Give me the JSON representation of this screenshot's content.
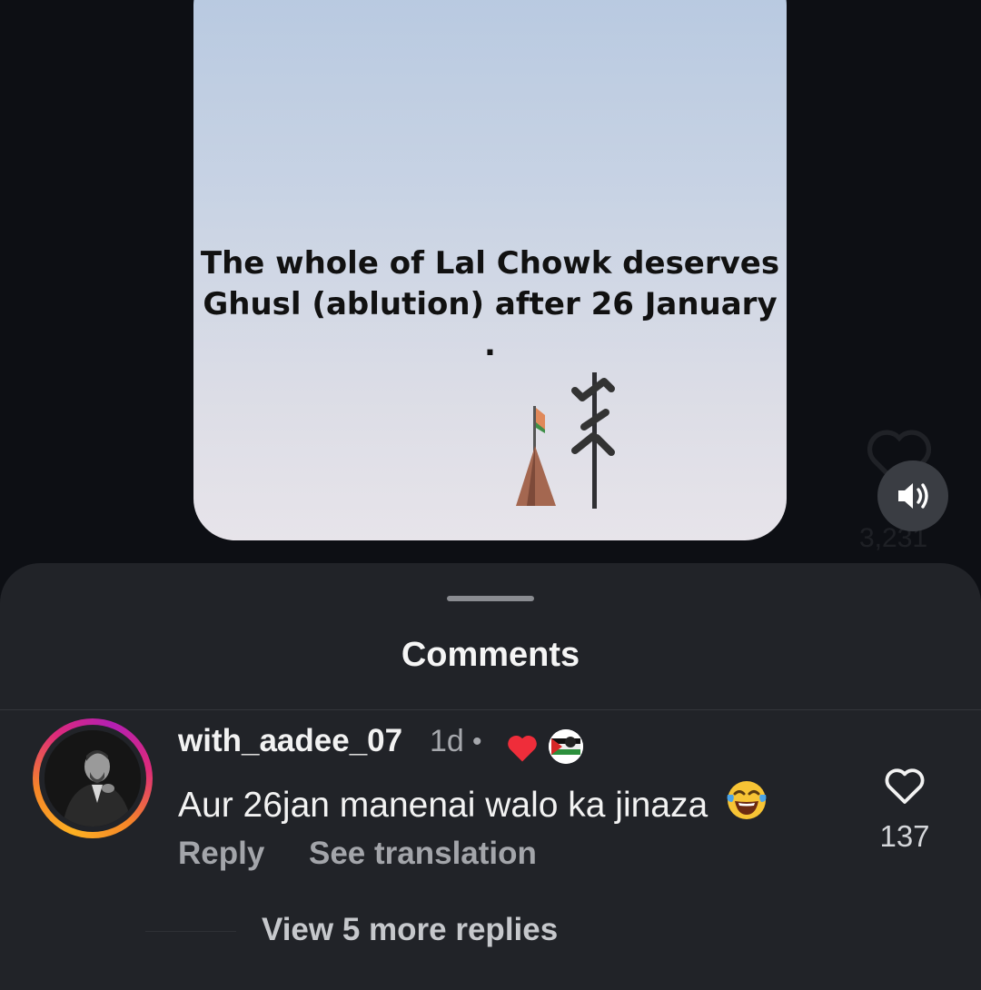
{
  "video": {
    "caption_line1": "The whole of Lal Chowk deserves",
    "caption_line2": "Ghusl (ablution) after 26 January .",
    "like_count_behind": "3,231"
  },
  "icons": {
    "sound": "speaker-icon",
    "like": "heart-outline-icon",
    "creator_like": "red-heart-icon",
    "emoji": "face-with-tears-of-joy-icon"
  },
  "comments_sheet": {
    "title": "Comments",
    "comment": {
      "username": "with_aadee_07",
      "time": "1d",
      "separator": "•",
      "text": "Aur 26jan manenai walo ka jinaza",
      "reply_label": "Reply",
      "translate_label": "See translation",
      "like_count": "137"
    },
    "view_replies_label": "View 5 more replies"
  },
  "colors": {
    "background": "#0d0f14",
    "sheet": "#212328",
    "creator_heart": "#ef2d3a",
    "ring_start": "#fdb022",
    "ring_end": "#b31fb3"
  }
}
